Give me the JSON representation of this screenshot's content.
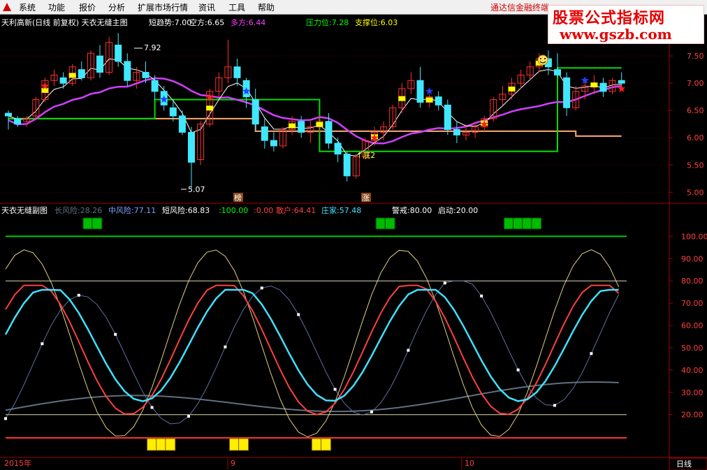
{
  "menu": {
    "items": [
      "系统",
      "功能",
      "报价",
      "分析",
      "扩展市场行情",
      "资讯",
      "工具",
      "帮助"
    ],
    "broker_title": "通达信金融终端"
  },
  "watermark": {
    "line1": "股票公式指标网",
    "line2": "www.gszb.com"
  },
  "main_header": {
    "title": "天利高新(日线 前复权) 天衣无缝主图",
    "items": [
      {
        "label": "短趋势:",
        "value": "7.00",
        "color": "#ffffff"
      },
      {
        "label": "空方:",
        "value": "6.65",
        "color": "#ffffff"
      },
      {
        "label": "多方:",
        "value": "6.44",
        "color": "#ff40ff"
      },
      {
        "label": "压力位:",
        "value": "7.28",
        "color": "#00ff00"
      },
      {
        "label": "支撑位:",
        "value": "6.03",
        "color": "#ffff00"
      }
    ]
  },
  "sub_header": {
    "title": "天衣无缝副图",
    "items": [
      {
        "label": "长风险:",
        "value": "28.26",
        "color": "#607080"
      },
      {
        "label": "中风险:",
        "value": "77.11",
        "color": "#80a0ff"
      },
      {
        "label": "短风险:",
        "value": "68.83",
        "color": "#ffffff"
      },
      {
        "label": ":",
        "value": "100.00",
        "color": "#00ff00"
      },
      {
        "label": ":",
        "value": "0.00",
        "color": "#ff4040"
      },
      {
        "label": "散户:",
        "value": "64.41",
        "color": "#ff4040"
      },
      {
        "label": "庄家:",
        "value": "57.48",
        "color": "#40e0ff"
      },
      {
        "label": "警戒:",
        "value": "80.00",
        "color": "#ffffff"
      },
      {
        "label": "启动:",
        "value": "20.00",
        "color": "#ffffff"
      }
    ]
  },
  "footer": {
    "year_label": "2015年",
    "month_labels": [
      "9",
      "10"
    ],
    "period": "日线"
  },
  "chart_data": [
    {
      "type": "candlestick",
      "title": "天利高新(日线 前复权) 天衣无缝主图",
      "y_ticks": [
        5.0,
        5.5,
        6.0,
        6.5,
        7.0,
        7.5
      ],
      "ylim": [
        4.85,
        7.95
      ],
      "annotations": {
        "high": "7.92",
        "low": "5.07",
        "bottom_label": "↑底2",
        "tag_left": "榜",
        "tag_right": "涨"
      },
      "candles": [
        [
          6.45,
          6.5,
          6.15,
          6.4
        ],
        [
          6.35,
          6.4,
          6.2,
          6.25
        ],
        [
          6.3,
          6.4,
          6.2,
          6.35
        ],
        [
          6.4,
          6.75,
          6.35,
          6.7
        ],
        [
          6.7,
          7.1,
          6.65,
          7.05
        ],
        [
          7.05,
          7.25,
          6.95,
          7.15
        ],
        [
          7.1,
          7.2,
          6.9,
          7.0
        ],
        [
          7.0,
          7.35,
          6.95,
          7.3
        ],
        [
          7.25,
          7.4,
          7.05,
          7.1
        ],
        [
          7.1,
          7.6,
          7.05,
          7.55
        ],
        [
          7.5,
          7.7,
          7.1,
          7.2
        ],
        [
          7.2,
          7.85,
          7.15,
          7.75
        ],
        [
          7.7,
          7.92,
          7.3,
          7.4
        ],
        [
          7.4,
          7.55,
          6.95,
          7.05
        ],
        [
          7.05,
          7.3,
          6.9,
          7.2
        ],
        [
          7.2,
          7.4,
          7.0,
          7.1
        ],
        [
          7.05,
          7.15,
          6.7,
          6.85
        ],
        [
          6.85,
          6.95,
          6.5,
          6.6
        ],
        [
          6.55,
          6.7,
          6.3,
          6.4
        ],
        [
          6.4,
          6.5,
          6.05,
          6.1
        ],
        [
          6.1,
          6.2,
          5.07,
          5.55
        ],
        [
          5.6,
          6.3,
          5.5,
          6.25
        ],
        [
          6.25,
          6.9,
          6.2,
          6.85
        ],
        [
          6.85,
          7.2,
          6.75,
          7.1
        ],
        [
          7.1,
          7.8,
          7.0,
          7.3
        ],
        [
          7.3,
          7.45,
          6.95,
          7.1
        ],
        [
          7.05,
          7.1,
          6.55,
          6.75
        ],
        [
          6.7,
          6.9,
          6.15,
          6.25
        ],
        [
          6.2,
          6.35,
          5.8,
          5.95
        ],
        [
          5.95,
          6.1,
          5.75,
          5.85
        ],
        [
          5.85,
          6.2,
          5.8,
          6.15
        ],
        [
          6.15,
          6.4,
          6.05,
          6.3
        ],
        [
          6.3,
          6.4,
          6.0,
          6.1
        ],
        [
          6.1,
          6.3,
          5.9,
          6.2
        ],
        [
          6.2,
          6.4,
          6.1,
          6.3
        ],
        [
          6.3,
          6.45,
          5.8,
          5.9
        ],
        [
          5.9,
          6.0,
          5.55,
          5.7
        ],
        [
          5.7,
          5.75,
          5.2,
          5.3
        ],
        [
          5.3,
          5.7,
          5.25,
          5.65
        ],
        [
          5.65,
          6.0,
          5.6,
          5.95
        ],
        [
          5.95,
          6.2,
          5.85,
          6.1
        ],
        [
          6.1,
          6.3,
          5.95,
          6.2
        ],
        [
          6.2,
          6.6,
          6.15,
          6.55
        ],
        [
          6.55,
          7.0,
          6.45,
          6.9
        ],
        [
          6.9,
          7.2,
          6.8,
          7.05
        ],
        [
          7.05,
          7.3,
          6.55,
          6.65
        ],
        [
          6.65,
          6.8,
          6.55,
          6.75
        ],
        [
          6.75,
          6.85,
          6.5,
          6.6
        ],
        [
          6.6,
          6.7,
          6.05,
          6.15
        ],
        [
          6.15,
          6.3,
          5.9,
          6.05
        ],
        [
          6.05,
          6.25,
          5.95,
          6.1
        ],
        [
          6.1,
          6.3,
          6.0,
          6.2
        ],
        [
          6.2,
          6.4,
          6.1,
          6.35
        ],
        [
          6.35,
          6.75,
          6.3,
          6.7
        ],
        [
          6.7,
          6.95,
          6.6,
          6.8
        ],
        [
          6.8,
          7.1,
          6.7,
          7.0
        ],
        [
          7.0,
          7.25,
          6.9,
          7.15
        ],
        [
          7.15,
          7.4,
          7.05,
          7.3
        ],
        [
          7.3,
          7.55,
          7.2,
          7.45
        ],
        [
          7.45,
          7.6,
          7.15,
          7.3
        ],
        [
          7.25,
          7.55,
          7.1,
          7.15
        ],
        [
          7.1,
          7.2,
          6.4,
          6.55
        ],
        [
          6.55,
          6.95,
          6.5,
          6.85
        ],
        [
          6.85,
          7.05,
          6.7,
          6.95
        ],
        [
          6.95,
          7.15,
          6.8,
          7.0
        ],
        [
          7.0,
          7.1,
          6.75,
          6.85
        ],
        [
          6.85,
          7.1,
          6.8,
          7.05
        ],
        [
          7.05,
          7.2,
          6.95,
          7.0
        ]
      ],
      "series": [
        {
          "name": "短趋势",
          "color": "#ffffff"
        },
        {
          "name": "多方",
          "color": "#d040ff"
        },
        {
          "name": "压力位",
          "color": "#00dd00"
        },
        {
          "name": "支撑位",
          "color": "#ffaa70"
        }
      ]
    },
    {
      "type": "line",
      "title": "天衣无缝副图",
      "y_ticks": [
        20,
        30,
        40,
        50,
        60,
        70,
        80,
        90,
        100
      ],
      "ylim": [
        3,
        107
      ],
      "reference_lines": [
        {
          "name": "警戒",
          "value": 80
        },
        {
          "name": "启动",
          "value": 20
        },
        {
          "name": "",
          "value": 100
        }
      ],
      "series": [
        {
          "name": "散户",
          "color": "#ff4040"
        },
        {
          "name": "庄家",
          "color": "#40e0ff"
        },
        {
          "name": "短风险",
          "color": "#e0d080"
        },
        {
          "name": "中风险",
          "color": "#6070a0"
        },
        {
          "name": "长风险",
          "color": "#607080"
        }
      ]
    }
  ]
}
